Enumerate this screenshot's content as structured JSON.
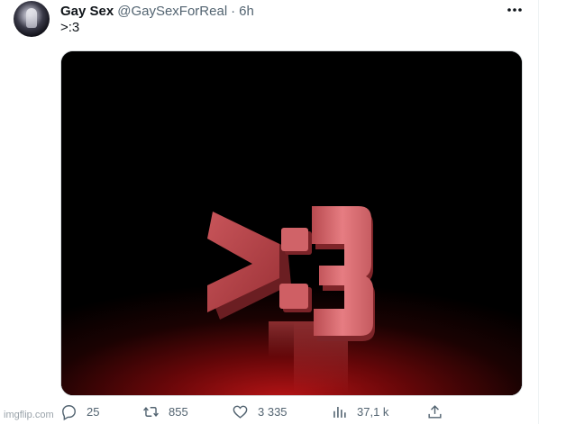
{
  "tweet": {
    "display_name": "Gay Sex",
    "handle": "@GaySexForReal",
    "separator": "·",
    "time": "6h",
    "text": ">:3",
    "media_alt": ">:3"
  },
  "actions": {
    "replies": "25",
    "reposts": "855",
    "likes": "3 335",
    "views": "37,1 k"
  },
  "icons": {
    "more": "more-horizontal-icon",
    "reply": "reply-icon",
    "repost": "repost-icon",
    "like": "heart-icon",
    "views": "views-chart-icon",
    "share": "share-icon"
  },
  "watermark": "imgflip.com",
  "colors": {
    "text_primary": "#0f1419",
    "text_secondary": "#536471",
    "media_red": "#c0302e"
  }
}
